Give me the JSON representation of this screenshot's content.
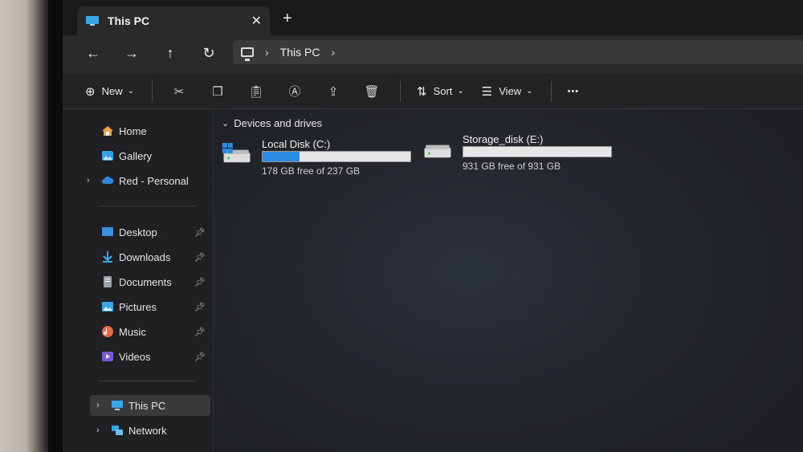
{
  "window": {
    "tab_title": "This PC",
    "tab_close": "✕",
    "new_tab": "+"
  },
  "nav": {
    "back": "←",
    "forward": "→",
    "up": "↑",
    "refresh": "↻",
    "breadcrumb": [
      "This PC"
    ],
    "breadcrumb_sep": "›"
  },
  "commands": {
    "new_label": "New",
    "sort_label": "Sort",
    "view_label": "View",
    "more": "•••",
    "icons": [
      "cut-icon",
      "copy-icon",
      "paste-icon",
      "rename-icon",
      "share-icon",
      "delete-icon"
    ]
  },
  "sidebar": {
    "top": [
      {
        "label": "Home",
        "icon": "home-icon",
        "color": "#f0a24a"
      },
      {
        "label": "Gallery",
        "icon": "gallery-icon",
        "color": "#3aa0e8"
      },
      {
        "label": "Red - Personal",
        "icon": "cloud-icon",
        "color": "#2f86d8",
        "expandable": true
      }
    ],
    "pinned": [
      {
        "label": "Desktop",
        "icon": "desktop-icon",
        "color": "#3b8fe0"
      },
      {
        "label": "Downloads",
        "icon": "downloads-icon",
        "color": "#38b0e0"
      },
      {
        "label": "Documents",
        "icon": "documents-icon",
        "color": "#9aa3ad"
      },
      {
        "label": "Pictures",
        "icon": "pictures-icon",
        "color": "#3aa6e6"
      },
      {
        "label": "Music",
        "icon": "music-icon",
        "color": "#e66a4a"
      },
      {
        "label": "Videos",
        "icon": "videos-icon",
        "color": "#7b58d8"
      }
    ],
    "bottom": [
      {
        "label": "This PC",
        "icon": "this-pc-icon",
        "color": "#3aa6e6",
        "selected": true
      },
      {
        "label": "Network",
        "icon": "network-icon",
        "color": "#3aa6e6"
      }
    ]
  },
  "content": {
    "section_title": "Devices and drives",
    "drives": [
      {
        "name": "Local Disk (C:)",
        "free_text": "178 GB free of 237 GB",
        "used_fraction": 0.249,
        "icon": "windows-drive-icon"
      },
      {
        "name": "Storage_disk (E:)",
        "free_text": "931 GB free of 931 GB",
        "used_fraction": 0.0,
        "icon": "drive-icon"
      }
    ]
  },
  "colors": {
    "accent": "#2a8be0",
    "background": "#1b1c1e"
  }
}
